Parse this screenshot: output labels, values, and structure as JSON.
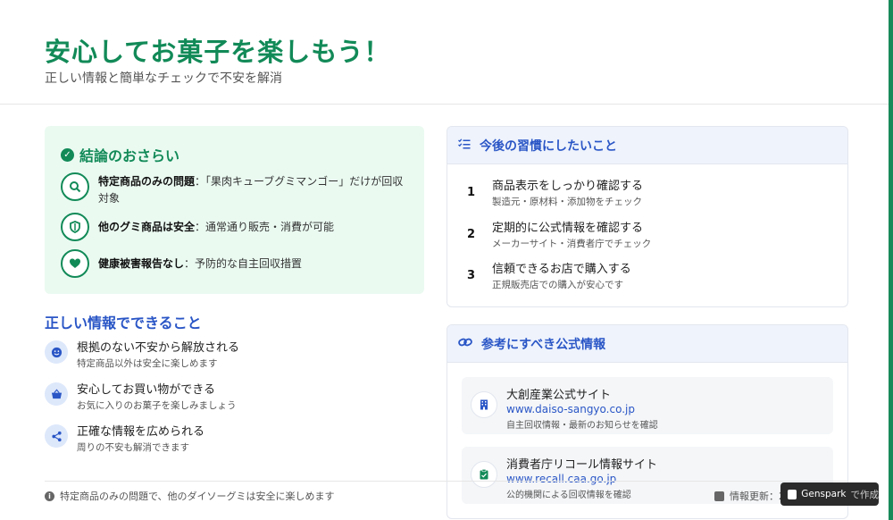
{
  "header": {
    "title": "安心してお菓子を楽しもう！",
    "subtitle": "正しい情報と簡単なチェックで不安を解消"
  },
  "summary": {
    "title": "結論のおさらい",
    "items": [
      {
        "bold": "特定商品のみの問題",
        "text": "：「果肉キューブグミマンゴー」だけが回収対象",
        "icon": "search-icon"
      },
      {
        "bold": "他のグミ商品は安全",
        "text": "：通常通り販売・消費が可能",
        "icon": "shield-icon"
      },
      {
        "bold": "健康被害報告なし",
        "text": "：予防的な自主回収措置",
        "icon": "heart-icon"
      }
    ]
  },
  "benefits": {
    "title": "正しい情報でできること",
    "items": [
      {
        "main": "根拠のない不安から解放される",
        "sub": "特定商品以外は安全に楽しめます",
        "icon": "smile-icon"
      },
      {
        "main": "安心してお買い物ができる",
        "sub": "お気に入りのお菓子を楽しみましょう",
        "icon": "basket-icon"
      },
      {
        "main": "正確な情報を広められる",
        "sub": "周りの不安も解消できます",
        "icon": "share-icon"
      }
    ]
  },
  "habits": {
    "title": "今後の習慣にしたいこと",
    "items": [
      {
        "num": "1",
        "main": "商品表示をしっかり確認する",
        "sub": "製造元・原材料・添加物をチェック"
      },
      {
        "num": "2",
        "main": "定期的に公式情報を確認する",
        "sub": "メーカーサイト・消費者庁でチェック"
      },
      {
        "num": "3",
        "main": "信頼できるお店で購入する",
        "sub": "正規販売店での購入が安心です"
      }
    ]
  },
  "references": {
    "title": "参考にすべき公式情報",
    "items": [
      {
        "name": "大創産業公式サイト",
        "url": "www.daiso-sangyo.co.jp",
        "desc": "自主回収情報・最新のお知らせを確認",
        "icon": "building-icon"
      },
      {
        "name": "消費者庁リコール情報サイト",
        "url": "www.recall.caa.go.jp",
        "desc": "公的機関による回収情報を確認",
        "icon": "clipboard-icon"
      }
    ]
  },
  "footer": {
    "note": "特定商品のみの問題で、他のダイソーグミは安全に楽しめます",
    "update": "情報更新：2"
  },
  "badge": {
    "brand": "Genspark",
    "suffix": "で作成"
  },
  "colors": {
    "green": "#128a58",
    "blue": "#2a56c6"
  }
}
